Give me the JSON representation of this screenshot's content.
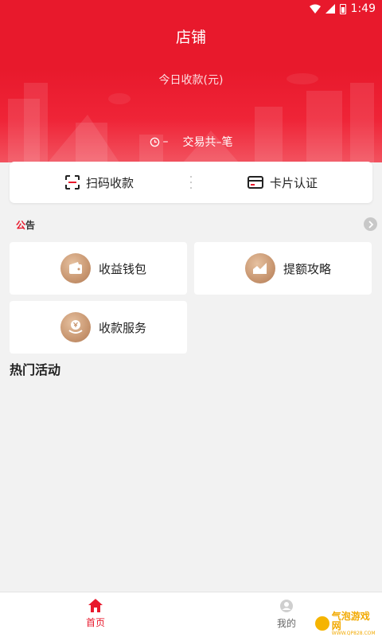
{
  "status_bar": {
    "time": "1:49"
  },
  "header": {
    "title": "店铺",
    "today_label": "今日收款(元)",
    "trade_time": "–",
    "trade_count_text": "交易共–笔"
  },
  "actions": {
    "scan_label": "扫码收款",
    "card_label": "卡片认证"
  },
  "notice": {
    "tag_first": "公",
    "tag_rest": "告"
  },
  "tiles": [
    {
      "label": "收益钱包",
      "icon": "wallet-icon"
    },
    {
      "label": "提额攻略",
      "icon": "chart-trend-icon"
    },
    {
      "label": "收款服务",
      "icon": "yen-hand-icon"
    }
  ],
  "section": {
    "hot_title": "热门活动"
  },
  "bottom_nav": {
    "home_label": "首页",
    "mine_label": "我的"
  },
  "watermark": {
    "text": "气泡游戏网",
    "sub": "WWW.QP828.COM"
  },
  "colors": {
    "brand_red": "#e8192c",
    "tile_icon": "#c89670",
    "background": "#f2f2f2"
  }
}
